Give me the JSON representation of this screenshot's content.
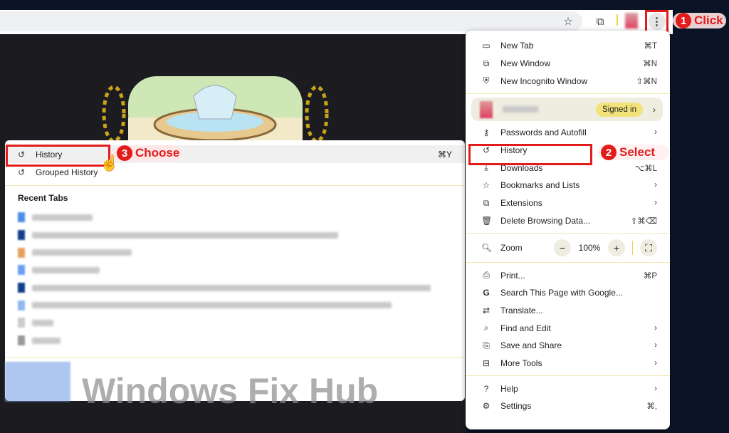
{
  "toolbar": {
    "icons": [
      "star-icon",
      "extension-icon",
      "profile-avatar",
      "more-vert-icon"
    ]
  },
  "annotations": {
    "step1": {
      "num": "1",
      "text": "Click"
    },
    "step2": {
      "num": "2",
      "text": "Select"
    },
    "step3": {
      "num": "3",
      "text": "Choose"
    },
    "color": "#e21b1b"
  },
  "menu": {
    "group1": [
      {
        "label": "New Tab",
        "shortcut": "⌘T",
        "icon": "new-tab-icon"
      },
      {
        "label": "New Window",
        "shortcut": "⌘N",
        "icon": "new-window-icon"
      },
      {
        "label": "New Incognito Window",
        "shortcut": "⇧⌘N",
        "icon": "incognito-icon"
      }
    ],
    "profile": {
      "signed_in": "Signed in"
    },
    "group2": [
      {
        "label": "Passwords and Autofill",
        "shortcut": "›",
        "icon": "key-icon"
      },
      {
        "label": "History",
        "shortcut": "",
        "icon": "history-icon"
      },
      {
        "label": "Downloads",
        "shortcut": "⌥⌘L",
        "icon": "download-icon"
      },
      {
        "label": "Bookmarks and Lists",
        "shortcut": "›",
        "icon": "star-icon"
      },
      {
        "label": "Extensions",
        "shortcut": "›",
        "icon": "extension-icon"
      },
      {
        "label": "Delete Browsing Data...",
        "shortcut": "⇧⌘⌫",
        "icon": "trash-icon"
      }
    ],
    "zoom": {
      "label": "Zoom",
      "minus": "−",
      "value": "100%",
      "plus": "+",
      "fullscreen": "⛶"
    },
    "group3": [
      {
        "label": "Print...",
        "shortcut": "⌘P",
        "icon": "print-icon"
      },
      {
        "label": "Search This Page with Google...",
        "shortcut": "",
        "icon": "google-icon"
      },
      {
        "label": "Translate...",
        "shortcut": "",
        "icon": "translate-icon"
      },
      {
        "label": "Find and Edit",
        "shortcut": "›",
        "icon": "find-icon"
      },
      {
        "label": "Save and Share",
        "shortcut": "›",
        "icon": "save-share-icon"
      },
      {
        "label": "More Tools",
        "shortcut": "›",
        "icon": "toolbox-icon"
      }
    ],
    "group4": [
      {
        "label": "Help",
        "shortcut": "›",
        "icon": "help-icon"
      },
      {
        "label": "Settings",
        "shortcut": "⌘,",
        "icon": "gear-icon"
      }
    ]
  },
  "submenu": {
    "history": {
      "label": "History",
      "shortcut": "⌘Y"
    },
    "grouped": {
      "label": "Grouped History"
    },
    "recent_tabs_title": "Recent Tabs"
  },
  "watermark": "Windows Fix Hub"
}
